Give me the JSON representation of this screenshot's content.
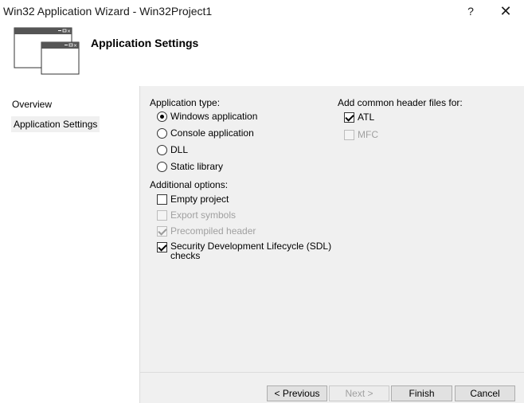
{
  "window": {
    "title": "Win32 Application Wizard - Win32Project1",
    "help_glyph": "?",
    "close_glyph": "✕"
  },
  "header": {
    "title": "Application Settings",
    "icon": "wizard-windows-icon"
  },
  "sidebar": {
    "items": [
      {
        "label": "Overview",
        "selected": false
      },
      {
        "label": "Application Settings",
        "selected": true
      }
    ]
  },
  "app_type": {
    "label": "Application type:",
    "options": [
      {
        "label": "Windows application",
        "checked": true
      },
      {
        "label": "Console application",
        "checked": false
      },
      {
        "label": "DLL",
        "checked": false
      },
      {
        "label": "Static library",
        "checked": false
      }
    ]
  },
  "additional": {
    "label": "Additional options:",
    "options": [
      {
        "label": "Empty project",
        "checked": false,
        "enabled": true
      },
      {
        "label": "Export symbols",
        "checked": false,
        "enabled": false
      },
      {
        "label": "Precompiled header",
        "checked": true,
        "enabled": false
      },
      {
        "label": "Security Development Lifecycle (SDL)",
        "label2": "checks",
        "checked": true,
        "enabled": true
      }
    ]
  },
  "headers": {
    "label": "Add common header files for:",
    "options": [
      {
        "label": "ATL",
        "checked": true,
        "enabled": true
      },
      {
        "label": "MFC",
        "checked": false,
        "enabled": false
      }
    ]
  },
  "buttons": {
    "previous": "< Previous",
    "next": "Next >",
    "finish": "Finish",
    "cancel": "Cancel"
  }
}
